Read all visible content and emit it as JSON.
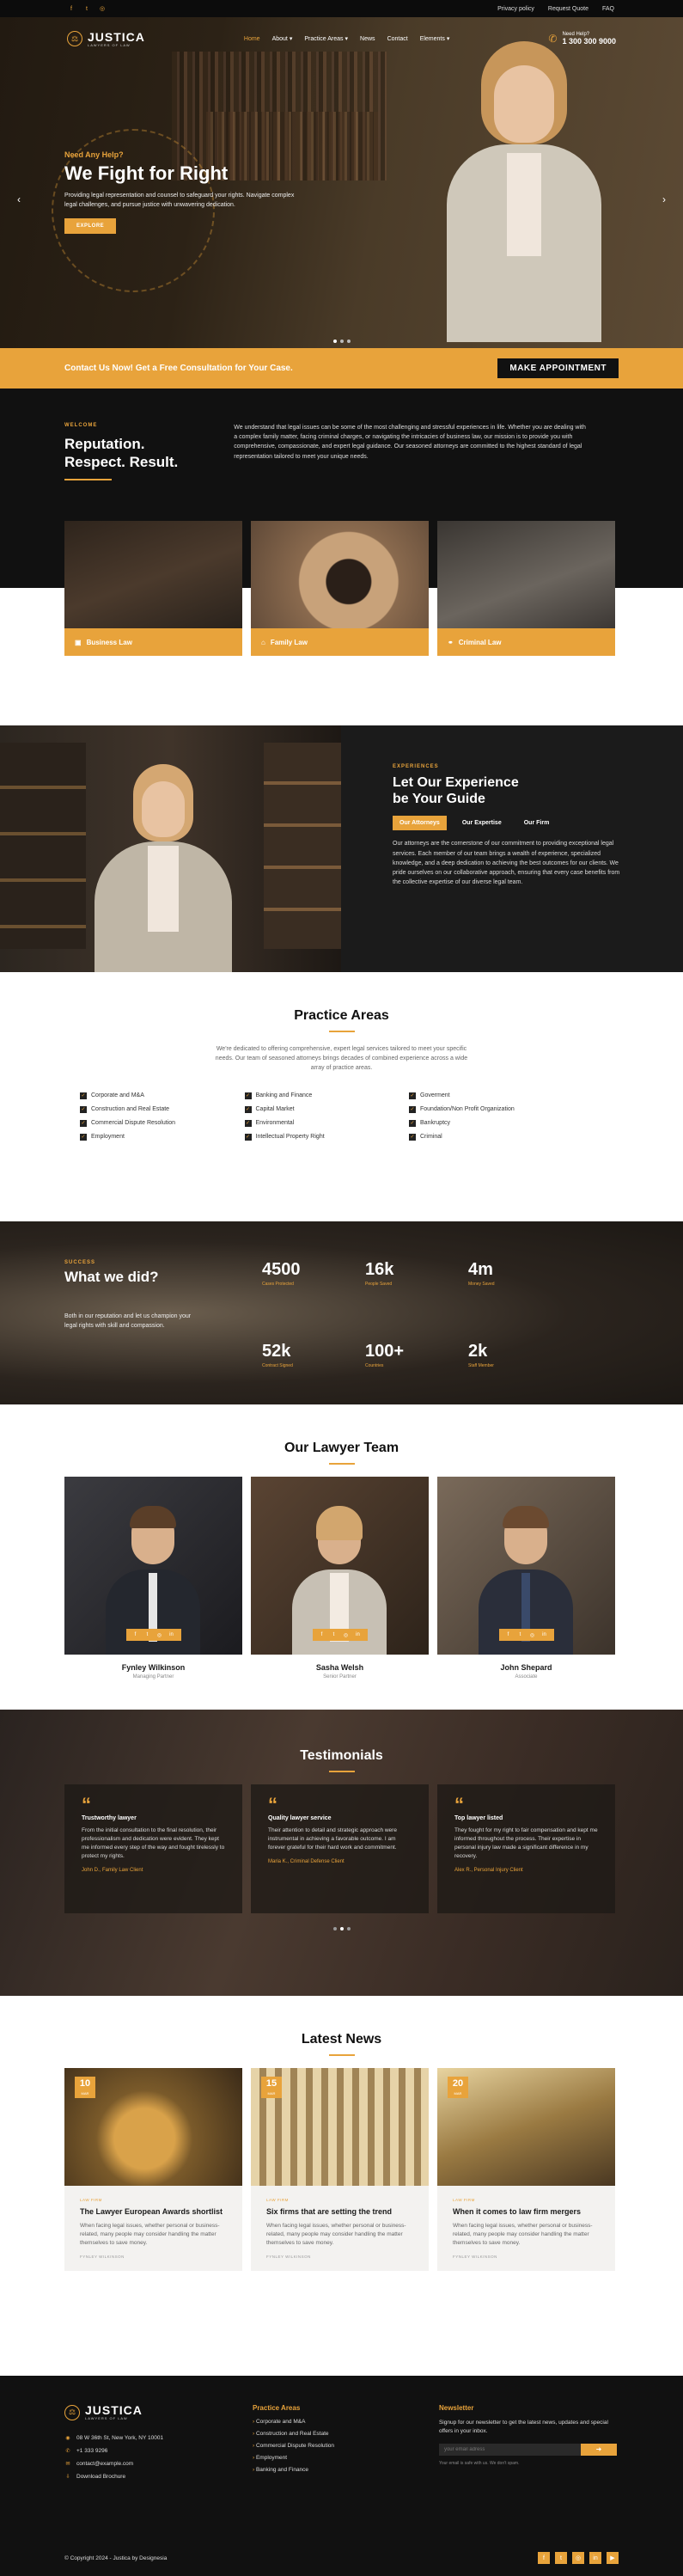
{
  "topbar": {
    "social": [
      "facebook-icon",
      "twitter-icon",
      "instagram-icon"
    ],
    "links": [
      "Privacy policy",
      "Request Quote",
      "FAQ"
    ]
  },
  "brand": {
    "name": "JUSTICA",
    "tagline": "LAWYERS OF LAW"
  },
  "nav": {
    "items": [
      {
        "label": "Home",
        "active": true
      },
      {
        "label": "About",
        "dropdown": true
      },
      {
        "label": "Practice Areas",
        "dropdown": true
      },
      {
        "label": "News"
      },
      {
        "label": "Contact"
      },
      {
        "label": "Elements",
        "dropdown": true
      }
    ],
    "help_label": "Need Help?",
    "phone": "1 300 300 9000"
  },
  "hero": {
    "kicker": "Need Any Help?",
    "title": "We Fight for Right",
    "text": "Providing legal representation and counsel to safeguard your rights. Navigate complex legal challenges, and pursue justice with unwavering dedication.",
    "button": "EXPLORE"
  },
  "cta": {
    "text": "Contact Us Now! Get a Free Consultation for Your Case.",
    "button": "MAKE APPOINTMENT"
  },
  "welcome": {
    "kicker": "WELCOME",
    "title_line1": "Reputation.",
    "title_line2": "Respect. Result.",
    "text": "We understand that legal issues can be some of the most challenging and stressful experiences in life. Whether you are dealing with a complex family matter, facing criminal charges, or navigating the intricacies of business law, our mission is to provide you with comprehensive, compassionate, and expert legal guidance. Our seasoned attorneys are committed to the highest standard of legal representation tailored to meet your unique needs."
  },
  "area_cards": [
    {
      "label": "Business Law",
      "icon": "briefcase-icon"
    },
    {
      "label": "Family Law",
      "icon": "house-icon"
    },
    {
      "label": "Criminal Law",
      "icon": "handcuffs-icon"
    }
  ],
  "experience": {
    "kicker": "EXPERIENCES",
    "title_line1": "Let Our Experience",
    "title_line2": "be Your Guide",
    "tabs": [
      {
        "label": "Our Attorneys",
        "active": true
      },
      {
        "label": "Our Expertise"
      },
      {
        "label": "Our Firm"
      }
    ],
    "text": "Our attorneys are the cornerstone of our commitment to providing exceptional legal services. Each member of our team brings a wealth of experience, specialized knowledge, and a deep dedication to achieving the best outcomes for our clients. We pride ourselves on our collaborative approach, ensuring that every case benefits from the collective expertise of our diverse legal team."
  },
  "practice": {
    "title": "Practice Areas",
    "intro": "We're dedicated to offering comprehensive, expert legal services tailored to meet your specific needs. Our team of seasoned attorneys brings decades of combined experience across a wide array of practice areas.",
    "columns": [
      [
        "Corporate and M&A",
        "Construction and Real Estate",
        "Commercial Dispute Resolution",
        "Employment"
      ],
      [
        "Banking and Finance",
        "Capital Market",
        "Environmental",
        "Intellectual Property Right"
      ],
      [
        "Goverment",
        "Foundation/Non Profit Organization",
        "Bankruptcy",
        "Criminal"
      ]
    ]
  },
  "stats": {
    "kicker": "SUCCESS",
    "title": "What we did?",
    "text": "Both in our reputation and let us champion your legal rights with skill and compassion.",
    "items": [
      {
        "value": "4500",
        "label": "Cases Protected"
      },
      {
        "value": "16k",
        "label": "People Saved"
      },
      {
        "value": "4m",
        "label": "Money Saved"
      },
      {
        "value": "52k",
        "label": "Contract Signed"
      },
      {
        "value": "100+",
        "label": "Countries"
      },
      {
        "value": "2k",
        "label": "Staff Member"
      }
    ]
  },
  "team": {
    "title": "Our Lawyer Team",
    "members": [
      {
        "name": "Fynley Wilkinson",
        "role": "Managing Partner"
      },
      {
        "name": "Sasha Welsh",
        "role": "Senior Partner"
      },
      {
        "name": "John Shepard",
        "role": "Associate"
      }
    ],
    "social": [
      "facebook-icon",
      "twitter-icon",
      "instagram-icon",
      "linkedin-icon"
    ]
  },
  "testimonials": {
    "title": "Testimonials",
    "items": [
      {
        "title": "Trustworthy lawyer",
        "text": "From the initial consultation to the final resolution, their professionalism and dedication were evident. They kept me informed every step of the way and fought tirelessly to protect my rights.",
        "author": "John D., Family Law Client"
      },
      {
        "title": "Quality lawyer service",
        "text": "Their attention to detail and strategic approach were instrumental in achieving a favorable outcome. I am forever grateful for their hard work and commitment.",
        "author": "Maria K., Criminal Defense Client"
      },
      {
        "title": "Top lawyer listed",
        "text": "They fought for my right to fair compensation and kept me informed throughout the process. Their expertise in personal injury law made a significant difference in my recovery.",
        "author": "Alex R., Personal Injury Client"
      }
    ]
  },
  "news": {
    "title": "Latest News",
    "items": [
      {
        "day": "10",
        "month": "MAR",
        "category": "LAW FIRM",
        "title": "The Lawyer European Awards shortlist",
        "text": "When facing legal issues, whether personal or business-related, many people may consider handling the matter themselves to save money.",
        "author": "FYNLEY WILKINSON"
      },
      {
        "day": "15",
        "month": "MAR",
        "category": "LAW FIRM",
        "title": "Six firms that are setting the trend",
        "text": "When facing legal issues, whether personal or business-related, many people may consider handling the matter themselves to save money.",
        "author": "FYNLEY WILKINSON"
      },
      {
        "day": "20",
        "month": "MAR",
        "category": "LAW FIRM",
        "title": "When it comes to law firm mergers",
        "text": "When facing legal issues, whether personal or business-related, many people may consider handling the matter themselves to save money.",
        "author": "FYNLEY WILKINSON"
      }
    ]
  },
  "footer": {
    "contact": [
      {
        "icon": "map-pin-icon",
        "text": "08 W 36th St, New York, NY 10001"
      },
      {
        "icon": "phone-icon",
        "text": "+1 333 9296"
      },
      {
        "icon": "mail-icon",
        "text": "contact@example.com"
      },
      {
        "icon": "download-icon",
        "text": "Download Brochure"
      }
    ],
    "practice_title": "Practice Areas",
    "practice_links": [
      "Corporate and M&A",
      "Construction and Real Estate",
      "Commercial Dispute Resolution",
      "Employment",
      "Banking and Finance"
    ],
    "newsletter_title": "Newsletter",
    "newsletter_text": "Signup for our newsletter to get the latest news, updates and special offers in your inbox.",
    "email_placeholder": "your email adress",
    "privacy_note": "Your email is safe with us. We don't spam.",
    "copyright": "© Copyright 2024 - Justica by Designesia",
    "social": [
      "facebook-icon",
      "twitter-icon",
      "instagram-icon",
      "linkedin-icon",
      "youtube-icon"
    ]
  },
  "colors": {
    "accent": "#e8a33b",
    "dark": "#111111"
  }
}
